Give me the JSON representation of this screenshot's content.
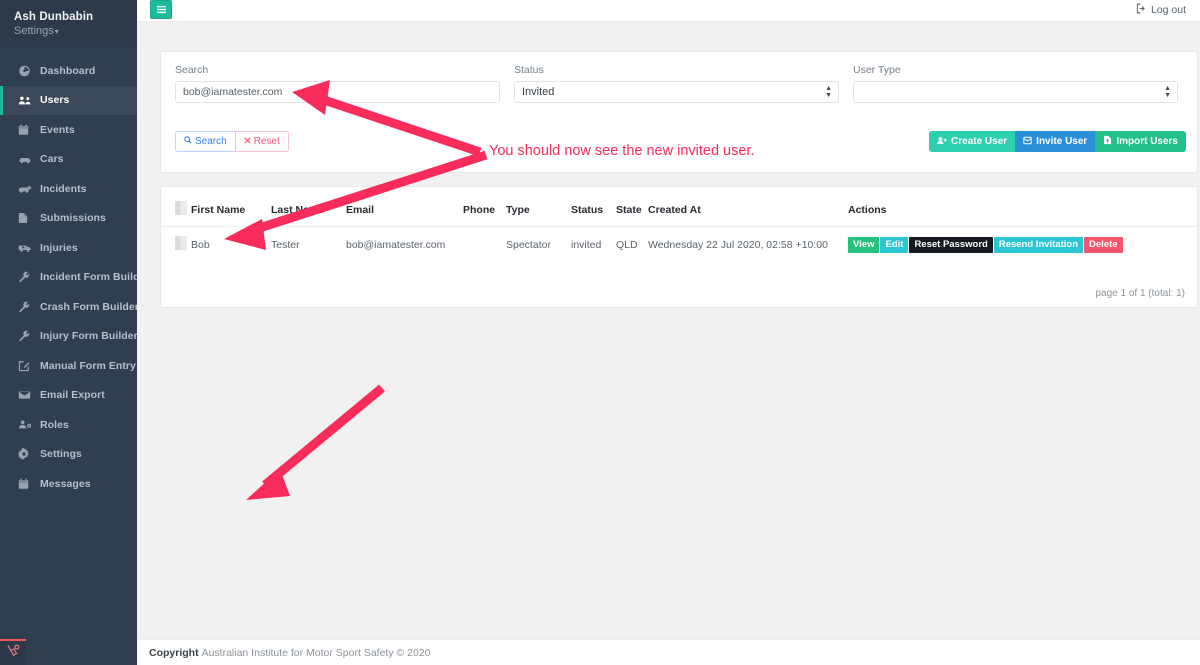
{
  "sidebar": {
    "user": {
      "name": "Ash Dunbabin",
      "settings_label": "Settings",
      "caret": "▾"
    },
    "items": [
      {
        "label": "Dashboard",
        "icon": "dashboard-icon",
        "active": false
      },
      {
        "label": "Users",
        "icon": "users-icon",
        "active": true
      },
      {
        "label": "Events",
        "icon": "calendar-icon",
        "active": false
      },
      {
        "label": "Cars",
        "icon": "car-icon",
        "active": false
      },
      {
        "label": "Incidents",
        "icon": "crash-icon",
        "active": false
      },
      {
        "label": "Submissions",
        "icon": "file-icon",
        "active": false
      },
      {
        "label": "Injuries",
        "icon": "ambulance-icon",
        "active": false
      },
      {
        "label": "Incident Form Builder",
        "icon": "wrench-icon",
        "active": false
      },
      {
        "label": "Crash Form Builder",
        "icon": "wrench-icon",
        "active": false
      },
      {
        "label": "Injury Form Builder",
        "icon": "wrench-icon",
        "active": false
      },
      {
        "label": "Manual Form Entry",
        "icon": "edit-square-icon",
        "active": false
      },
      {
        "label": "Email Export",
        "icon": "envelope-icon",
        "active": false
      },
      {
        "label": "Roles",
        "icon": "user-gear-icon",
        "active": false
      },
      {
        "label": "Settings",
        "icon": "gear-icon",
        "active": false
      },
      {
        "label": "Messages",
        "icon": "calendar-icon",
        "active": false
      }
    ],
    "debugbar_icon": "laravel-logo-icon"
  },
  "topbar": {
    "menu_icon": "hamburger-icon",
    "logout_label": "Log out",
    "logout_icon": "sign-out-icon"
  },
  "filters": {
    "search": {
      "label": "Search",
      "value": "bob@iamatester.com",
      "placeholder": ""
    },
    "status": {
      "label": "Status",
      "value": "Invited"
    },
    "user_type": {
      "label": "User Type",
      "value": ""
    },
    "search_button": {
      "label": "Search",
      "icon": "search-icon"
    },
    "reset_button": {
      "label": "Reset",
      "icon": "close-icon"
    },
    "create_user_button": {
      "label": "Create User",
      "icon": "user-plus-icon",
      "color": "#2ecfb0"
    },
    "invite_user_button": {
      "label": "Invite User",
      "icon": "envelope-open-icon",
      "color": "#2b8fd8"
    },
    "import_users_button": {
      "label": "Import Users",
      "icon": "upload-file-icon",
      "color": "#22c08a"
    }
  },
  "table": {
    "columns": [
      "",
      "First Name",
      "Last Name",
      "Email",
      "Phone",
      "Type",
      "Status",
      "State",
      "Created At",
      "Actions"
    ],
    "rows": [
      {
        "first_name": "Bob",
        "last_name": "Tester",
        "email": "bob@iamatester.com",
        "phone": "",
        "type": "Spectator",
        "status": "invited",
        "state": "QLD",
        "created_at": "Wednesday 22 Jul 2020, 02:58 +10:00",
        "actions": [
          {
            "label": "View",
            "color": "#27c17e"
          },
          {
            "label": "Edit",
            "color": "#2bc5d4"
          },
          {
            "label": "Reset Password",
            "color": "#15181c"
          },
          {
            "label": "Resend Invitation",
            "color": "#2bc5d4"
          },
          {
            "label": "Delete",
            "color": "#f3556c"
          }
        ]
      }
    ],
    "pagination": "page 1 of 1 (total: 1)"
  },
  "footer": {
    "copyright_bold": "Copyright",
    "copyright_text": "Australian Institute for Motor Sport Safety © 2020"
  },
  "annotation": {
    "text": "You should now see the new invited user.",
    "color": "#f72c5b"
  }
}
